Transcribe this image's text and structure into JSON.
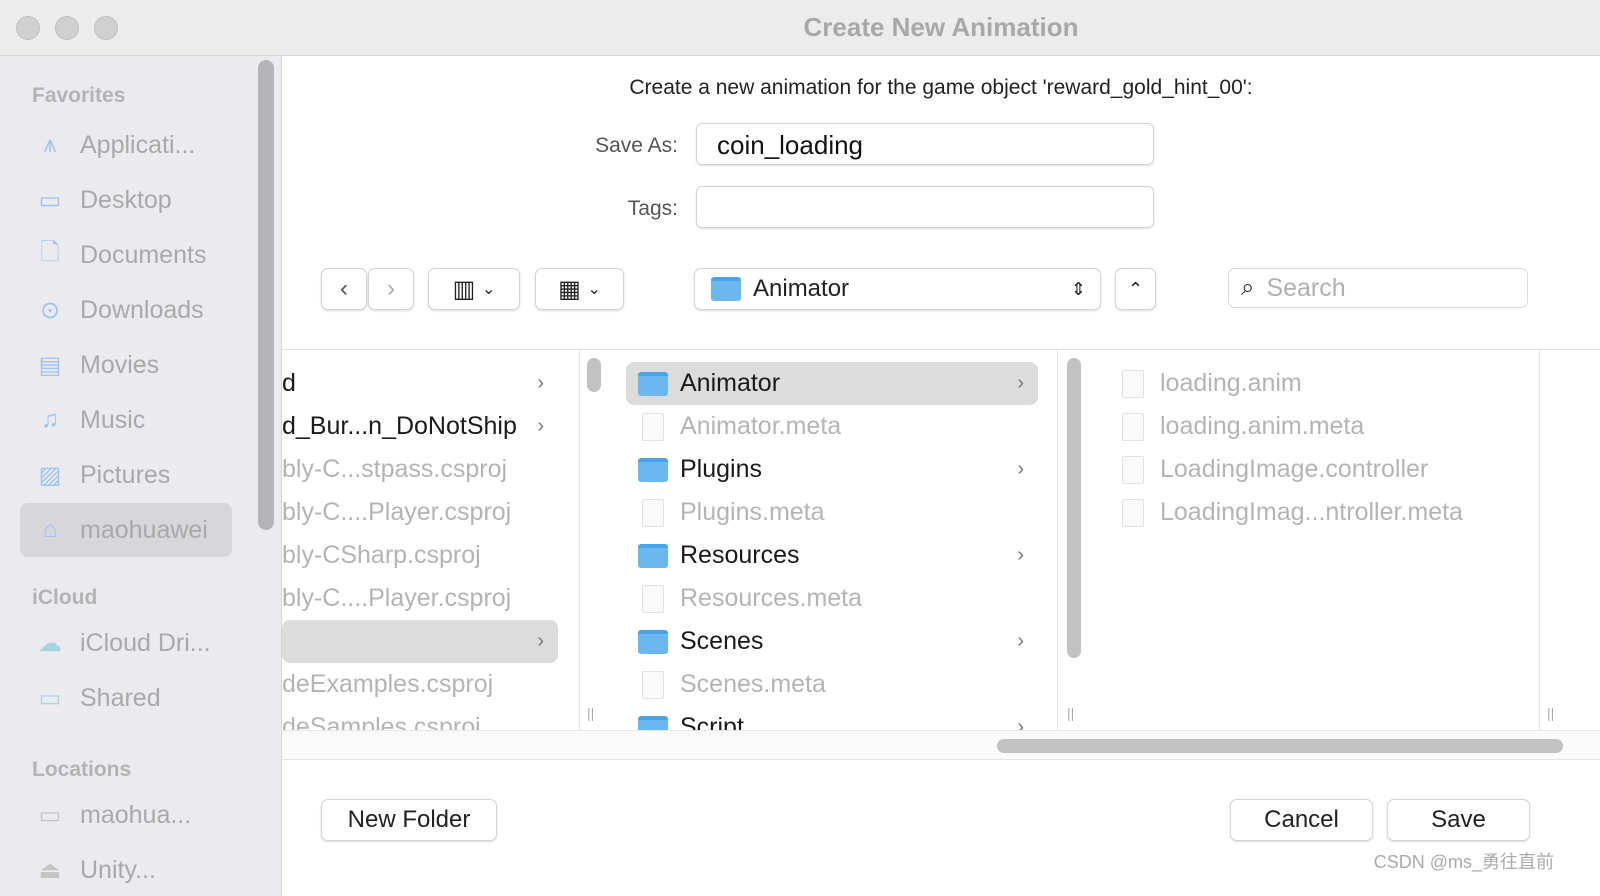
{
  "window": {
    "title": "Create New Animation"
  },
  "sidebar": {
    "sections": [
      {
        "title": "Favorites",
        "items": [
          {
            "label": "Applicati...",
            "icon": "applications-icon"
          },
          {
            "label": "Desktop",
            "icon": "desktop-icon"
          },
          {
            "label": "Documents",
            "icon": "document-icon"
          },
          {
            "label": "Downloads",
            "icon": "download-icon"
          },
          {
            "label": "Movies",
            "icon": "film-icon"
          },
          {
            "label": "Music",
            "icon": "music-note-icon"
          },
          {
            "label": "Pictures",
            "icon": "photo-icon"
          },
          {
            "label": "maohuawei",
            "icon": "home-icon",
            "selected": true
          }
        ]
      },
      {
        "title": "iCloud",
        "items": [
          {
            "label": "iCloud Dri...",
            "icon": "cloud-icon"
          },
          {
            "label": "Shared",
            "icon": "shared-folder-icon"
          }
        ]
      },
      {
        "title": "Locations",
        "items": [
          {
            "label": "maohua...",
            "icon": "laptop-icon"
          },
          {
            "label": "Unity...",
            "icon": "disk-icon"
          }
        ]
      }
    ]
  },
  "form": {
    "prompt": "Create a new animation for the game object 'reward_gold_hint_00':",
    "save_as_label": "Save As:",
    "save_as_value": "coin_loading",
    "tags_label": "Tags:",
    "tags_value": ""
  },
  "toolbar": {
    "location": "Animator",
    "search_placeholder": "Search"
  },
  "columns": [
    [
      {
        "name": "d",
        "kind": "folder",
        "dark": true
      },
      {
        "name": "d_Bur...n_DoNotShip",
        "kind": "folder",
        "dark": true
      },
      {
        "name": "bly-C...stpass.csproj"
      },
      {
        "name": "bly-C....Player.csproj"
      },
      {
        "name": "bly-CSharp.csproj"
      },
      {
        "name": "bly-C....Player.csproj"
      },
      {
        "name": "",
        "kind": "folder",
        "selected": true
      },
      {
        "name": "deExamples.csproj"
      },
      {
        "name": "deSamples.csproj"
      }
    ],
    [
      {
        "name": "Animator",
        "kind": "folder",
        "selected": true
      },
      {
        "name": "Animator.meta"
      },
      {
        "name": "Plugins",
        "kind": "folder"
      },
      {
        "name": "Plugins.meta"
      },
      {
        "name": "Resources",
        "kind": "folder"
      },
      {
        "name": "Resources.meta"
      },
      {
        "name": "Scenes",
        "kind": "folder"
      },
      {
        "name": "Scenes.meta"
      },
      {
        "name": "Script",
        "kind": "folder"
      }
    ],
    [
      {
        "name": "loading.anim"
      },
      {
        "name": "loading.anim.meta"
      },
      {
        "name": "LoadingImage.controller"
      },
      {
        "name": "LoadingImag...ntroller.meta"
      }
    ]
  ],
  "footer": {
    "new_folder": "New Folder",
    "cancel": "Cancel",
    "save": "Save"
  },
  "watermark": "CSDN @ms_勇往直前"
}
